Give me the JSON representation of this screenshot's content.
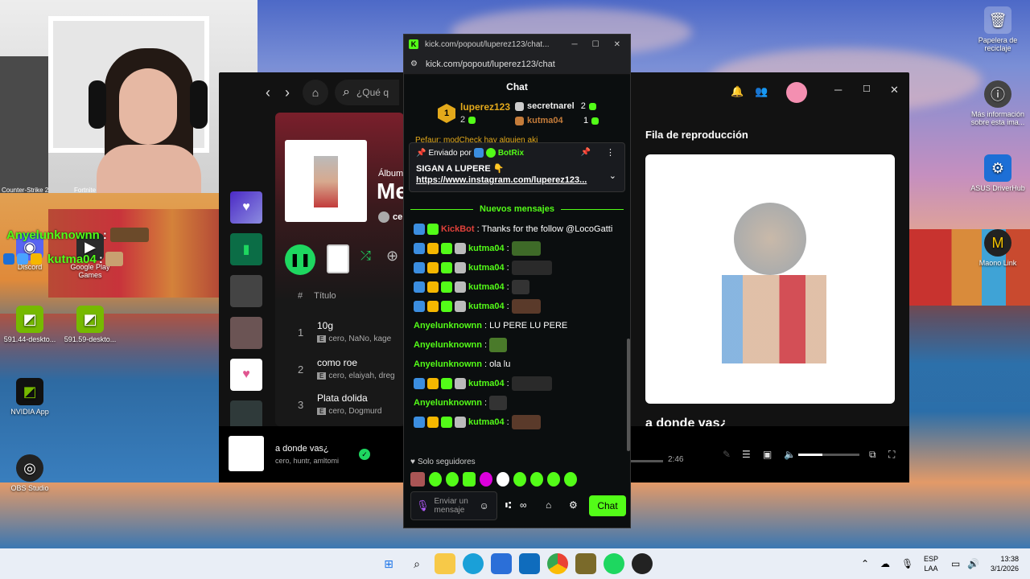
{
  "desktop": {
    "icons_right": [
      {
        "label": "Papelera de reciclaje",
        "icon": "recycle-bin-icon"
      },
      {
        "label": "Más información sobre esta ima...",
        "icon": "info-icon"
      },
      {
        "label": "ASUS DriverHub",
        "icon": "asus-icon"
      },
      {
        "label": "Maono Link",
        "icon": "maono-icon"
      }
    ],
    "icons_left": [
      {
        "label": "Discord"
      },
      {
        "label": "Google Play Games"
      },
      {
        "label": "591.44-deskto..."
      },
      {
        "label": "591.59-deskto..."
      },
      {
        "label": "NVIDIA App"
      },
      {
        "label": "OBS Studio"
      }
    ],
    "partial_labels": [
      "Counter-Strike 2",
      "Fortnite"
    ]
  },
  "overlay": {
    "user1": "Anyelunknownn",
    "user2": "kutma04",
    "sep": ":"
  },
  "spotify": {
    "search_placeholder": "¿Qué q",
    "album_label": "Álbum",
    "album_title": "Me",
    "artist_partial": "ce",
    "list_header": {
      "num": "#",
      "title": "Título"
    },
    "tracks": [
      {
        "num": "1",
        "title": "10g",
        "artists": "cero, NaNo, kage"
      },
      {
        "num": "2",
        "title": "como roe",
        "artists": "cero, elaiyah, dreg"
      },
      {
        "num": "3",
        "title": "Plata dolida",
        "artists": "cero, Dogmurd"
      }
    ],
    "explicit": "E",
    "queue_title": "Fila de reproducción",
    "queue_now": "a donde vas¿",
    "now_playing": {
      "title": "a donde vas¿",
      "artists": "cero, huntr, amltomi",
      "duration": "2:46"
    }
  },
  "chat": {
    "tab_title": "kick.com/popout/luperez123/chat...",
    "url": "kick.com/popout/luperez123/chat",
    "header": "Chat",
    "leaderboard": {
      "rank": "1",
      "first": {
        "name": "luperez123",
        "count": "2"
      },
      "second": {
        "name": "secretnarel",
        "count": "2"
      },
      "third": {
        "name": "kutma04",
        "count": "1"
      }
    },
    "hidden_msg": "Pefaur: modCheck hay alguien aki",
    "pinned": {
      "prefix": "Enviado por",
      "by": "BotRix",
      "text": "SIGAN A LUPERE 👇",
      "link": "https://www.instagram.com/luperez123..."
    },
    "new_messages": "Nuevos mensajes",
    "messages": [
      {
        "user": "KickBot",
        "text": ": Thanks for the follow @LocoGatti",
        "type": "bot"
      },
      {
        "user": "kutma04",
        "text": ":",
        "type": "emote"
      },
      {
        "user": "kutma04",
        "text": ":",
        "type": "emote"
      },
      {
        "user": "kutma04",
        "text": ":",
        "type": "emote"
      },
      {
        "user": "kutma04",
        "text": ":",
        "type": "emote"
      },
      {
        "user": "Anyelunknownn",
        "text": ": LU PERE LU PERE",
        "type": "plain"
      },
      {
        "user": "Anyelunknownn",
        "text": ":",
        "type": "plainemote"
      },
      {
        "user": "Anyelunknownn",
        "text": ": ola lu",
        "type": "plain"
      },
      {
        "user": "kutma04",
        "text": ":",
        "type": "emote"
      },
      {
        "user": "Anyelunknownn",
        "text": ":",
        "type": "plainemote"
      },
      {
        "user": "kutma04",
        "text": ":",
        "type": "emote"
      }
    ],
    "followers_only": "Solo seguidores",
    "input_placeholder": "Enviar un mensaje",
    "send_button": "Chat"
  },
  "taskbar": {
    "lang": "ESP",
    "lang2": "LAA",
    "time": "13:38",
    "date": "3/1/2026"
  },
  "colors": {
    "kick_green": "#53fc18",
    "spotify_green": "#1ed760"
  }
}
